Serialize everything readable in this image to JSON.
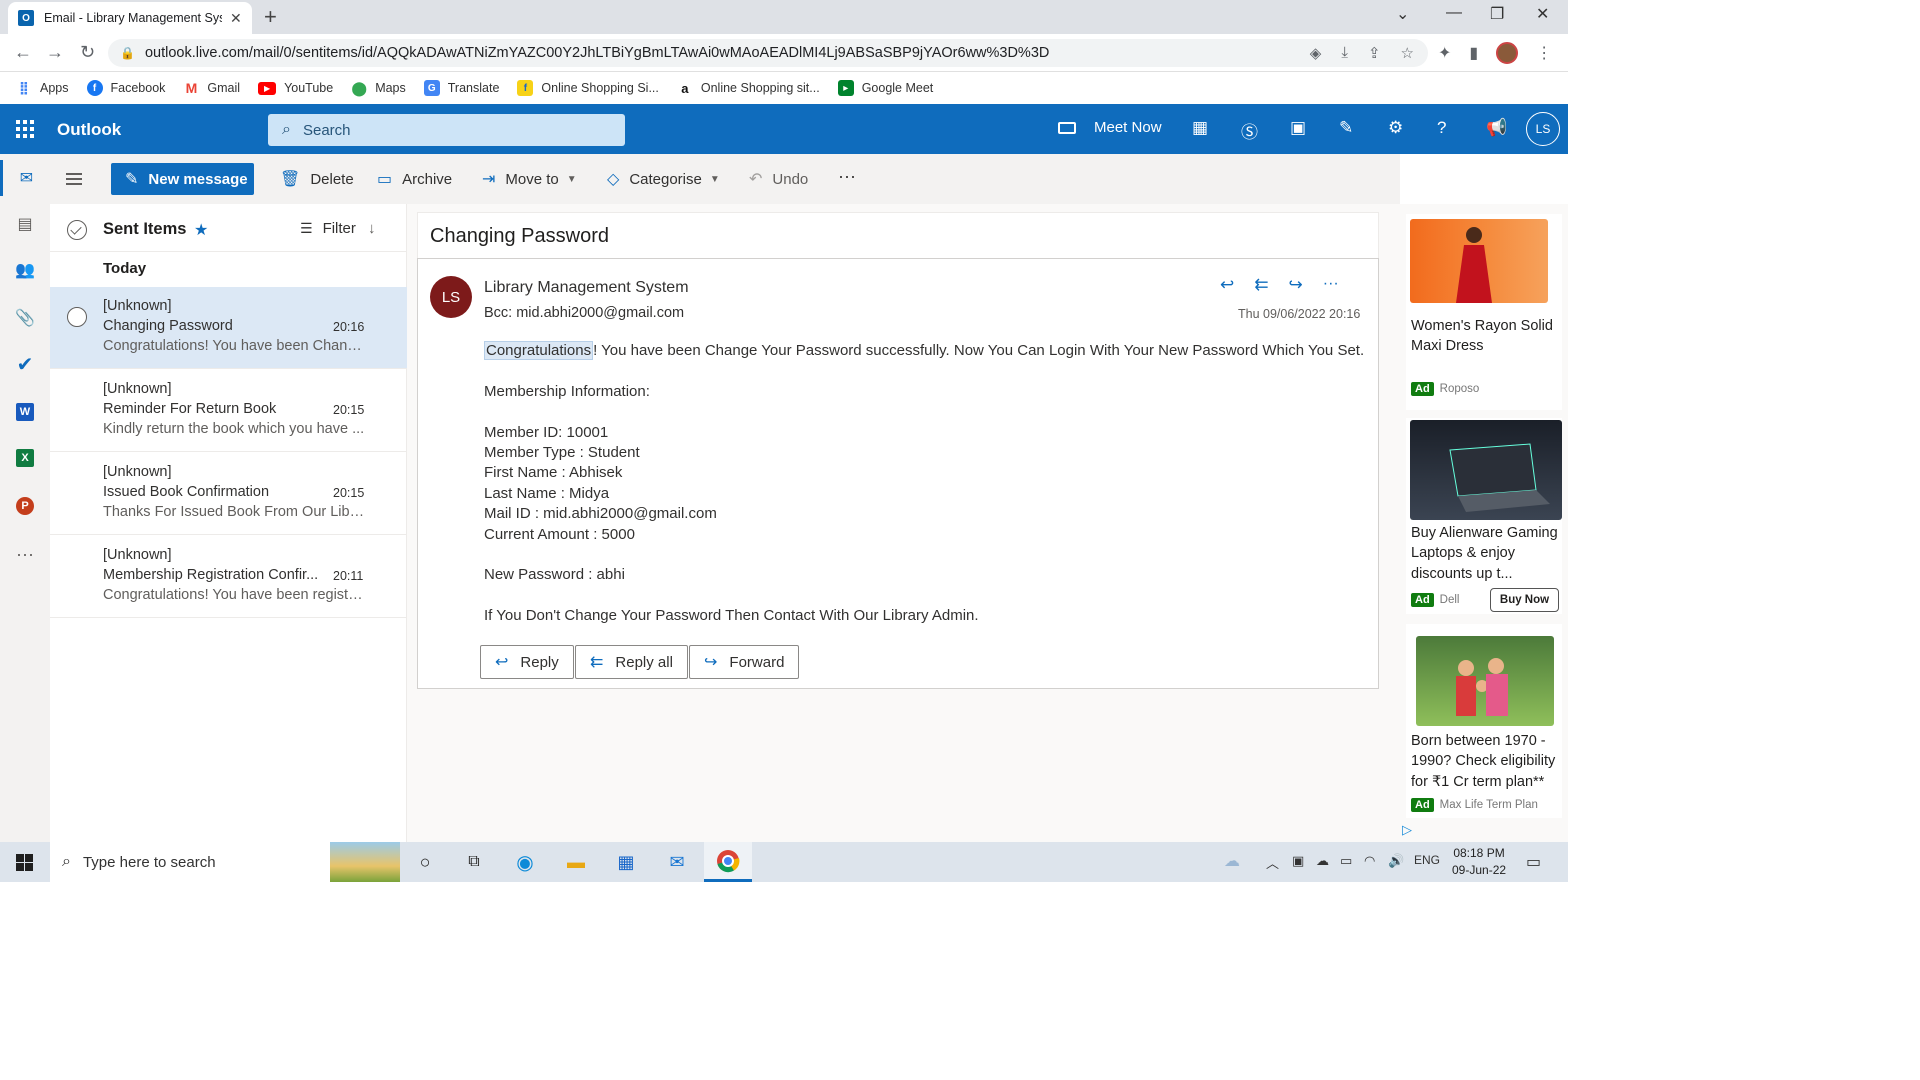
{
  "browser": {
    "tab_title": "Email - Library Management Syst",
    "url": "outlook.live.com/mail/0/sentitems/id/AQQkADAwATNiZmYAZC00Y2JhLTBiYgBmLTAwAi0wMAoAEADlMI4Lj9ABSaSBP9jYAOr6ww%3D%3D",
    "bookmarks": [
      "Apps",
      "Facebook",
      "Gmail",
      "YouTube",
      "Maps",
      "Translate",
      "Online Shopping Si...",
      "Online Shopping sit...",
      "Google Meet"
    ]
  },
  "outlook": {
    "brand": "Outlook",
    "search_placeholder": "Search",
    "meet_now": "Meet Now",
    "avatar": "LS"
  },
  "commands": {
    "new_message": "New message",
    "delete": "Delete",
    "archive": "Archive",
    "move_to": "Move to",
    "categorise": "Categorise",
    "undo": "Undo",
    "more": "···"
  },
  "list": {
    "folder": "Sent Items",
    "filter": "Filter",
    "group": "Today",
    "items": [
      {
        "sender": "[Unknown]",
        "subject": "Changing Password",
        "time": "20:16",
        "preview": "Congratulations! You have been Chang..."
      },
      {
        "sender": "[Unknown]",
        "subject": "Reminder For Return Book",
        "time": "20:15",
        "preview": "Kindly return the book which you have ..."
      },
      {
        "sender": "[Unknown]",
        "subject": "Issued Book Confirmation",
        "time": "20:15",
        "preview": "Thanks For Issued Book From Our Libra..."
      },
      {
        "sender": "[Unknown]",
        "subject": "Membership Registration Confir...",
        "time": "20:11",
        "preview": "Congratulations! You have been registe..."
      }
    ]
  },
  "message": {
    "subject": "Changing Password",
    "avatar": "LS",
    "from": "Library Management System",
    "bcc": "Bcc:  mid.abhi2000@gmail.com",
    "date": "Thu 09/06/2022 20:16",
    "congrats": "Congratulations",
    "line1_rest": "! You have been Change Your Password successfully. Now You Can Login With Your New Password Which You Set.",
    "membership_heading": "Membership Information:",
    "member_id": "Member ID: 10001",
    "member_type": "Member Type : Student",
    "first_name": "First Name : Abhisek",
    "last_name": "Last Name : Midya",
    "mail_id": "Mail ID : mid.abhi2000@gmail.com",
    "current_amount": "Current Amount : 5000",
    "new_password": "New Password : abhi",
    "closing": "If You Don't Change Your Password Then Contact With Our Library Admin.",
    "reply": "Reply",
    "reply_all": "Reply all",
    "forward": "Forward"
  },
  "ads": [
    {
      "title": "Women's Rayon Solid Maxi Dress",
      "tag": "Ad",
      "source": "Roposo"
    },
    {
      "title": "Buy Alienware Gaming Laptops & enjoy discounts up t...",
      "tag": "Ad",
      "source": "Dell",
      "cta": "Buy Now"
    },
    {
      "title": "Born between 1970 - 1990? Check eligibility for ₹1 Cr term plan**",
      "tag": "Ad",
      "source": "Max Life Term Plan"
    }
  ],
  "taskbar": {
    "search_placeholder": "Type here to search",
    "lang": "ENG",
    "time": "08:18 PM",
    "date": "09-Jun-22"
  }
}
